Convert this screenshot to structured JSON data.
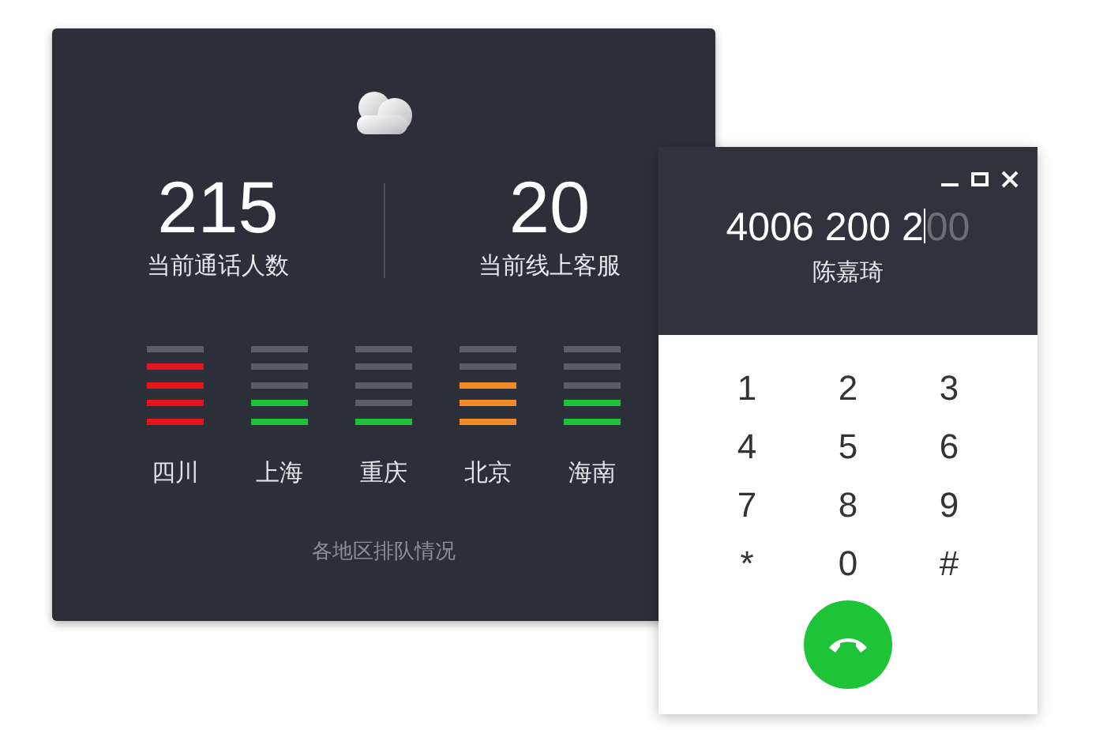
{
  "stats": [
    {
      "value": "215",
      "label": "当前通话人数"
    },
    {
      "value": "20",
      "label": "当前线上客服"
    }
  ],
  "regions": [
    {
      "name": "四川",
      "level": 0.8,
      "color": "#e8141b"
    },
    {
      "name": "上海",
      "level": 0.4,
      "color": "#1ec337"
    },
    {
      "name": "重庆",
      "level": 0.2,
      "color": "#1ec337"
    },
    {
      "name": "北京",
      "level": 0.6,
      "color": "#f28a26"
    },
    {
      "name": "海南",
      "level": 0.4,
      "color": "#1ec337"
    }
  ],
  "caption": "各地区排队情况",
  "dialer": {
    "typed": "4006 200 2",
    "suggestion": "00",
    "contact": "陈嘉琦",
    "keys": [
      "1",
      "2",
      "3",
      "4",
      "5",
      "6",
      "7",
      "8",
      "9",
      "*",
      "0",
      "#"
    ]
  }
}
